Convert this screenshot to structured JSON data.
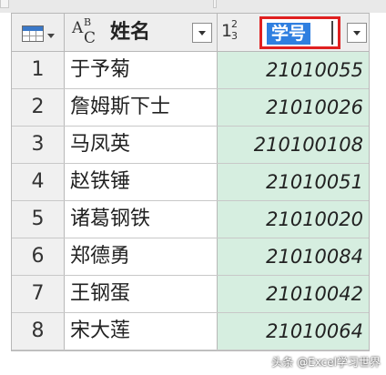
{
  "table": {
    "columns": [
      {
        "name": "姓名",
        "type_icon": "text-type-icon",
        "type_glyph": {
          "a": "A",
          "b": "B",
          "c": "C"
        }
      },
      {
        "name": "学号",
        "type_icon": "number-type-icon",
        "type_glyph": {
          "one": "1",
          "two": "2",
          "three": "3"
        },
        "editing": true
      }
    ],
    "rows": [
      {
        "index": "1",
        "name": "于予菊",
        "id": "21010055"
      },
      {
        "index": "2",
        "name": "詹姆斯下士",
        "id": "21010026"
      },
      {
        "index": "3",
        "name": "马凤英",
        "id": "210100108"
      },
      {
        "index": "4",
        "name": "赵铁锤",
        "id": "21010051"
      },
      {
        "index": "5",
        "name": "诸葛钢铁",
        "id": "21010020"
      },
      {
        "index": "6",
        "name": "郑德勇",
        "id": "21010084"
      },
      {
        "index": "7",
        "name": "王钢蛋",
        "id": "21010042"
      },
      {
        "index": "8",
        "name": "宋大莲",
        "id": "21010064"
      }
    ]
  },
  "watermark": "头条 @Excel学习世界",
  "colors": {
    "highlight_box": "#e02020",
    "selection": "#2f7fe0",
    "id_column_bg": "#d6eee0",
    "header_bg": "#eeeeee"
  }
}
